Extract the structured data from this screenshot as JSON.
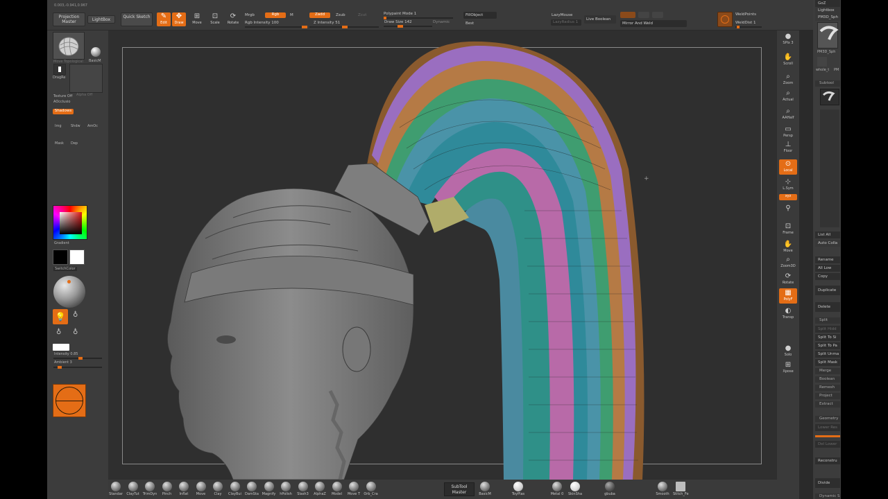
{
  "app": {
    "coords": "0.003,-0.941,0.967"
  },
  "top": {
    "projection_master": "Projection Master",
    "lightbox": "LightBox",
    "quick_sketch": "Quick Sketch",
    "tools": [
      {
        "label": "Edit",
        "icon": "edit-icon",
        "on": true
      },
      {
        "label": "Draw",
        "icon": "draw-icon",
        "on": true
      },
      {
        "label": "Move",
        "icon": "move-icon",
        "on": false
      },
      {
        "label": "Scale",
        "icon": "scale-icon",
        "on": false
      },
      {
        "label": "Rotate",
        "icon": "rotate-icon",
        "on": false
      }
    ],
    "mrgb": "Mrgb",
    "rgb": "Rgb",
    "m": "M",
    "rgb_intensity_label": "Rgb Intensity",
    "rgb_intensity_value": "100",
    "zadd": "Zadd",
    "zsub": "Zsub",
    "zcut": "Zcut",
    "z_intensity_label": "Z Intensity",
    "z_intensity_value": "51",
    "z_intensity_fraction": 0.51,
    "polypaint_mode": "Polypaint Mode 1",
    "draw_size_label": "Draw Size",
    "draw_size_value": "142",
    "dynamic": "Dynamic",
    "fillobject": "FillObject",
    "best": "Best",
    "lazymouse": "LazyMouse",
    "lazyradius": "LazyRadius 1",
    "live_boolean": "Live Boolean",
    "mirror_and_weld": "Mirror And Weld",
    "weld_points": "WeldPoints",
    "weld_dist": "WeldDist 1"
  },
  "left": {
    "brush_name": "Move Topological",
    "basic_mat": "BasicM",
    "dragrect": "DragRe",
    "alpha_off": "Alpha Off",
    "texture_off": "Texture Off",
    "aoccl": "AOcclusio",
    "shadows": "Shadows",
    "img": "Img",
    "shdw": "Shdw",
    "amoc": "AmOc",
    "mask": "Mask",
    "dep": "Dep",
    "gradient": "Gradient",
    "switch_color": "SwitchColor",
    "intensity_label": "Intensity",
    "intensity_value": "0.85",
    "ambient_label": "Ambient",
    "ambient_value": "3"
  },
  "rshelf": [
    {
      "label": "SPix 3",
      "icon": "spix-icon",
      "on": false
    },
    {
      "label": "Scroll",
      "icon": "hand-icon",
      "on": false
    },
    {
      "label": "Zoom",
      "icon": "zoom-icon",
      "on": false
    },
    {
      "label": "Actual",
      "icon": "actual-icon",
      "on": false
    },
    {
      "label": "AAHalf",
      "icon": "aahalf-icon",
      "on": false
    },
    {
      "label": "Persp",
      "icon": "persp-icon",
      "on": false
    },
    {
      "label": "Floor",
      "icon": "floor-icon",
      "on": false
    },
    {
      "label": "Local",
      "icon": "local-icon",
      "on": true
    },
    {
      "label": "L.Sym",
      "icon": "lsym-icon",
      "on": false
    },
    {
      "label": "xyz",
      "icon": "xyz-icon",
      "on": true
    },
    {
      "label": "Frame",
      "icon": "frame-icon",
      "on": false
    },
    {
      "label": "Move",
      "icon": "move-icon",
      "on": false
    },
    {
      "label": "Zoom3D",
      "icon": "zoom3d-icon",
      "on": false
    },
    {
      "label": "Rotate",
      "icon": "rotate-icon",
      "on": false
    },
    {
      "label": "PolyF",
      "icon": "polyf-icon",
      "on": true
    },
    {
      "label": "Transp",
      "icon": "transp-icon",
      "on": false
    },
    {
      "label": "Solo",
      "icon": "solo-icon",
      "on": false
    },
    {
      "label": "Xpose",
      "icon": "xpose-icon",
      "on": false
    }
  ],
  "rtray": {
    "goz": "GoZ",
    "lightbox": "Lightbox",
    "pm3d": "PM3D_Sph",
    "pm3d_short": "PM3D_Sph",
    "whole": "whole_t",
    "pm": "PM",
    "subtool": "Subtool",
    "list_all": "List All",
    "auto_collapse": "Auto Colla",
    "rename": "Rename",
    "all_low": "All Low",
    "copy": "Copy",
    "duplicate": "Duplicate",
    "delete": "Delete",
    "split": "Split",
    "split_hidden": "Split Hidd",
    "split_to_similar": "Split To Si",
    "split_to_parts": "Split To Pa",
    "split_unmasked": "Split Unma",
    "split_masked": "Split Mask",
    "merge": "Merge",
    "boolean": "Boolean",
    "remesh": "Remesh",
    "project": "Project",
    "extract": "Extract",
    "geometry": "Geometry",
    "lower_res": "Lower Res",
    "del_lower": "Del Lower",
    "reconstruct": "Reconstru",
    "divide": "Divide",
    "dynamic_sub": "Dynamic S"
  },
  "bottom": {
    "brushes": [
      "Standar",
      "ClayTut",
      "TrimDyn",
      "Pinch",
      "Inflat",
      "Move",
      "Clay",
      "ClayBui",
      "DamSta",
      "Magnify",
      "hPolish",
      "Slash3",
      "AlphaZ",
      "Model",
      "Move T",
      "Orb_Cra"
    ],
    "subtool_master": "SubTool Master",
    "basic_mat": "BasicM",
    "toy_plas": "ToyPlas",
    "metal": "Metal 0",
    "skin_sha": "SkinSha",
    "gbuba": "gbuba",
    "smooth": "Smooth",
    "stitch": "Stitch_Fe"
  }
}
